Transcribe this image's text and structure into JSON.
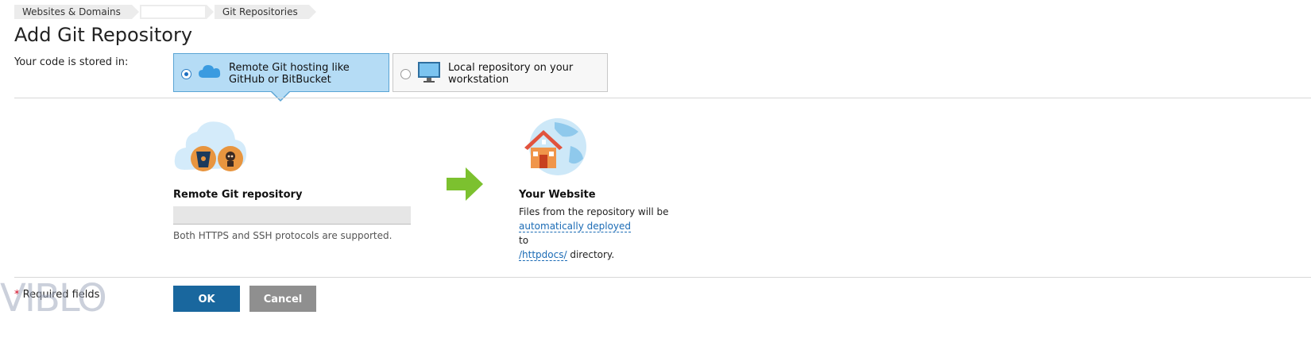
{
  "breadcrumb": {
    "items": [
      "Websites & Domains",
      "",
      "Git Repositories"
    ]
  },
  "page": {
    "title": "Add Git Repository",
    "stored_label": "Your code is stored in:"
  },
  "storage_options": {
    "remote": {
      "label": "Remote Git hosting like GitHub or BitBucket",
      "selected": true,
      "icon": "cloud-icon"
    },
    "local": {
      "label": "Local repository on your workstation",
      "selected": false,
      "icon": "monitor-icon"
    }
  },
  "remote_repo": {
    "label": "Remote Git repository",
    "value": "",
    "hint": "Both HTTPS and SSH protocols are supported.",
    "icons": [
      "cloud-icon",
      "bitbucket-icon",
      "github-octocat-icon"
    ]
  },
  "website": {
    "label": "Your Website",
    "text_before": "Files from the repository will be",
    "deploy_link": "automatically deployed",
    "to_text": "to",
    "dir_link": "/httpdocs/",
    "dir_suffix": " directory."
  },
  "footer": {
    "required_star": "*",
    "required_text": " Required fields",
    "ok_label": "OK",
    "cancel_label": "Cancel"
  },
  "watermark": {
    "text": "VIBLO"
  },
  "colors": {
    "selected_bg": "#b5dcf5",
    "ok_button": "#19679e",
    "cancel_button": "#8f8f8f",
    "link": "#1b6bb5",
    "arrow": "#7cc12f"
  }
}
